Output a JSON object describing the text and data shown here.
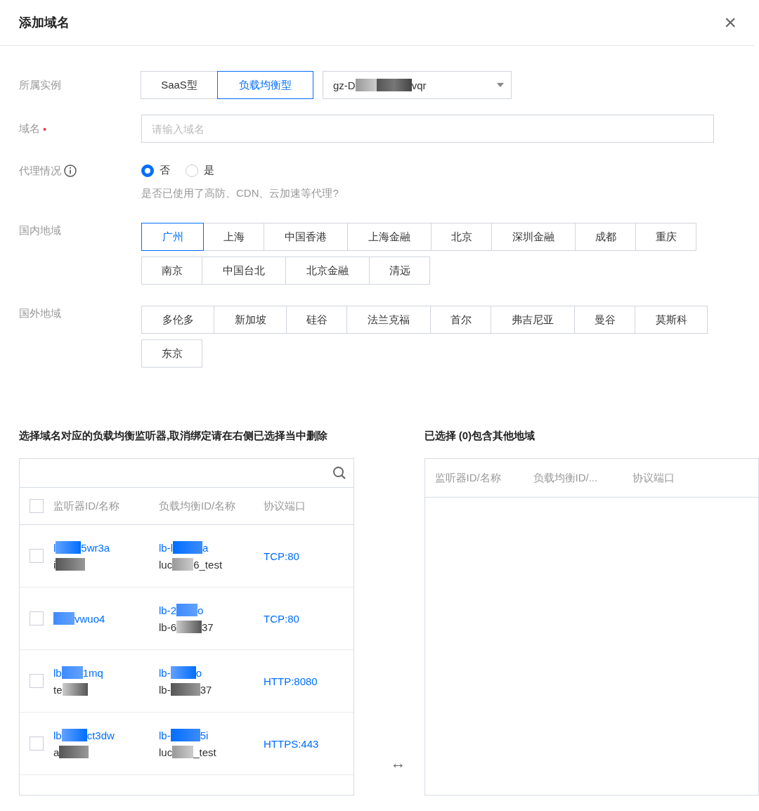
{
  "dialog": {
    "title": "添加域名",
    "close": "×"
  },
  "instance": {
    "label": "所属实例",
    "types": [
      {
        "label": "SaaS型",
        "selected": false
      },
      {
        "label": "负载均衡型",
        "selected": true
      }
    ],
    "select_parts": [
      "gz-D",
      "vqr"
    ]
  },
  "domain": {
    "label": "域名",
    "required_mark": "•",
    "placeholder": "请输入域名"
  },
  "proxy": {
    "label": "代理情况",
    "options": [
      {
        "label": "否",
        "selected": true
      },
      {
        "label": "是",
        "selected": false
      }
    ],
    "hint": "是否已使用了高防、CDN、云加速等代理?"
  },
  "domestic": {
    "label": "国内地域",
    "regions": [
      {
        "label": "广州",
        "selected": true
      },
      {
        "label": "上海",
        "selected": false
      },
      {
        "label": "中国香港",
        "selected": false
      },
      {
        "label": "上海金融",
        "selected": false
      },
      {
        "label": "北京",
        "selected": false
      },
      {
        "label": "深圳金融",
        "selected": false
      },
      {
        "label": "成都",
        "selected": false
      },
      {
        "label": "重庆",
        "selected": false
      },
      {
        "label": "南京",
        "selected": false
      },
      {
        "label": "中国台北",
        "selected": false
      },
      {
        "label": "北京金融",
        "selected": false
      },
      {
        "label": "清远",
        "selected": false
      }
    ]
  },
  "overseas": {
    "label": "国外地域",
    "regions": [
      {
        "label": "多伦多",
        "selected": false
      },
      {
        "label": "新加坡",
        "selected": false
      },
      {
        "label": "硅谷",
        "selected": false
      },
      {
        "label": "法兰克福",
        "selected": false
      },
      {
        "label": "首尔",
        "selected": false
      },
      {
        "label": "弗吉尼亚",
        "selected": false
      },
      {
        "label": "曼谷",
        "selected": false
      },
      {
        "label": "莫斯科",
        "selected": false
      },
      {
        "label": "东京",
        "selected": false
      }
    ]
  },
  "left": {
    "title": "选择域名对应的负载均衡监听器,取消绑定请在右侧已选择当中删除",
    "all_checked": false,
    "columns": [
      "监听器ID/名称",
      "负载均衡ID/名称",
      "协议端口"
    ],
    "rows": [
      {
        "checked": false,
        "listener": [
          [
            "l",
            "5wr3a"
          ],
          [
            "i"
          ]
        ],
        "lb": [
          [
            "lb-l",
            "a"
          ],
          [
            "luc",
            "6_test"
          ]
        ],
        "port": "TCP:80"
      },
      {
        "checked": false,
        "listener_lead_mask": true,
        "listener": [
          [
            "vwuo4"
          ]
        ],
        "lb": [
          [
            "lb-2",
            "o"
          ],
          [
            "lb-6",
            "37"
          ]
        ],
        "port": "TCP:80"
      },
      {
        "checked": false,
        "listener": [
          [
            "lb",
            "1mq"
          ],
          [
            "te"
          ]
        ],
        "lb": [
          [
            "lb-",
            "o"
          ],
          [
            "lb-",
            "37"
          ]
        ],
        "port": "HTTP:8080"
      },
      {
        "checked": false,
        "listener": [
          [
            "lb",
            "ct3dw"
          ],
          [
            "a"
          ]
        ],
        "lb": [
          [
            "lb-",
            "5i"
          ],
          [
            "luc",
            "_test"
          ]
        ],
        "port": "HTTPS:443"
      }
    ]
  },
  "transfer_icon": "↔",
  "right": {
    "title": "已选择 (0)包含其他地域",
    "columns": [
      "监听器ID/名称",
      "负载均衡ID/...",
      "协议端口"
    ]
  }
}
